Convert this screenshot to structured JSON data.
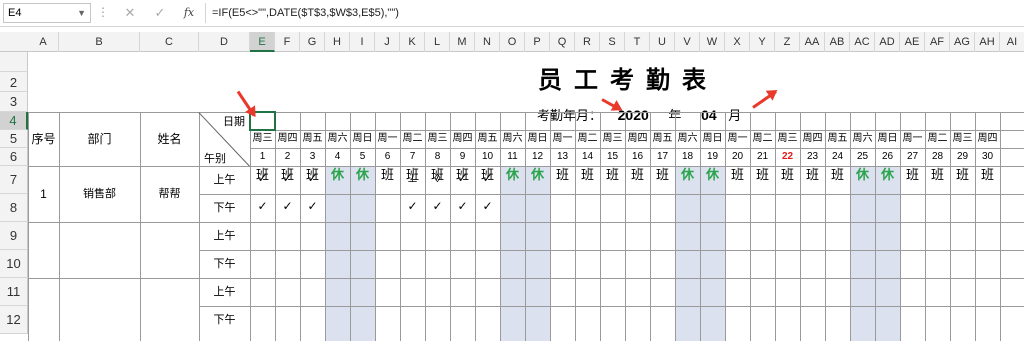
{
  "formula_bar": {
    "name_box": "E4",
    "formula": "=IF(E5<>\"\",DATE($T$3,$W$3,E$5),\"\")",
    "cancel_icon": "✕",
    "confirm_icon": "✓",
    "fx_label": "fx"
  },
  "columns": [
    "A",
    "B",
    "C",
    "D",
    "E",
    "F",
    "G",
    "H",
    "I",
    "J",
    "K",
    "L",
    "M",
    "N",
    "O",
    "P",
    "Q",
    "R",
    "S",
    "T",
    "U",
    "V",
    "W",
    "X",
    "Y",
    "Z",
    "AA",
    "AB",
    "AC",
    "AD",
    "AE",
    "AF",
    "AG",
    "AH",
    "AI"
  ],
  "selected_column": "E",
  "rows": [
    "1",
    "2",
    "3",
    "4",
    "5",
    "6",
    "7",
    "8",
    "9",
    "10",
    "11",
    "12"
  ],
  "selected_row": "4",
  "sheet": {
    "title": "员工考勤表",
    "month_label": "考勤年月：",
    "year": "2020",
    "year_unit": "年",
    "month": "04",
    "month_unit": "月",
    "header": {
      "date": "日期",
      "noon": "午别",
      "seq": "序号",
      "dept": "部门",
      "name": "姓名"
    },
    "weekdays": [
      "周三",
      "周四",
      "周五",
      "周六",
      "周日",
      "周一",
      "周二",
      "周三",
      "周四",
      "周五",
      "周六",
      "周日",
      "周一",
      "周二",
      "周三",
      "周四",
      "周五",
      "周六",
      "周日",
      "周一",
      "周二",
      "周三",
      "周四",
      "周五",
      "周六",
      "周日",
      "周一",
      "周二",
      "周三",
      "周四"
    ],
    "days": [
      "1",
      "2",
      "3",
      "4",
      "5",
      "6",
      "7",
      "8",
      "9",
      "10",
      "11",
      "12",
      "13",
      "14",
      "15",
      "16",
      "17",
      "18",
      "19",
      "20",
      "21",
      "22",
      "23",
      "24",
      "25",
      "26",
      "27",
      "28",
      "29",
      "30"
    ],
    "highlight_day": "22",
    "day_types": [
      "班",
      "班",
      "班",
      "休",
      "休",
      "班",
      "班",
      "班",
      "班",
      "班",
      "休",
      "休",
      "班",
      "班",
      "班",
      "班",
      "班",
      "休",
      "休",
      "班",
      "班",
      "班",
      "班",
      "班",
      "休",
      "休",
      "班",
      "班",
      "班",
      "班"
    ],
    "employee": {
      "seq": "1",
      "dept": "销售部",
      "name": "帮帮"
    },
    "periods": [
      "上午",
      "下午",
      "上午",
      "下午",
      "上午",
      "下午"
    ],
    "am_marks": [
      "✓",
      "✓",
      "✓",
      "",
      "",
      "",
      "⊥",
      "◊",
      "✓",
      "✓"
    ],
    "pm_marks": [
      "✓",
      "✓",
      "✓",
      "",
      "",
      "",
      "✓",
      "✓",
      "✓",
      "✓"
    ]
  }
}
